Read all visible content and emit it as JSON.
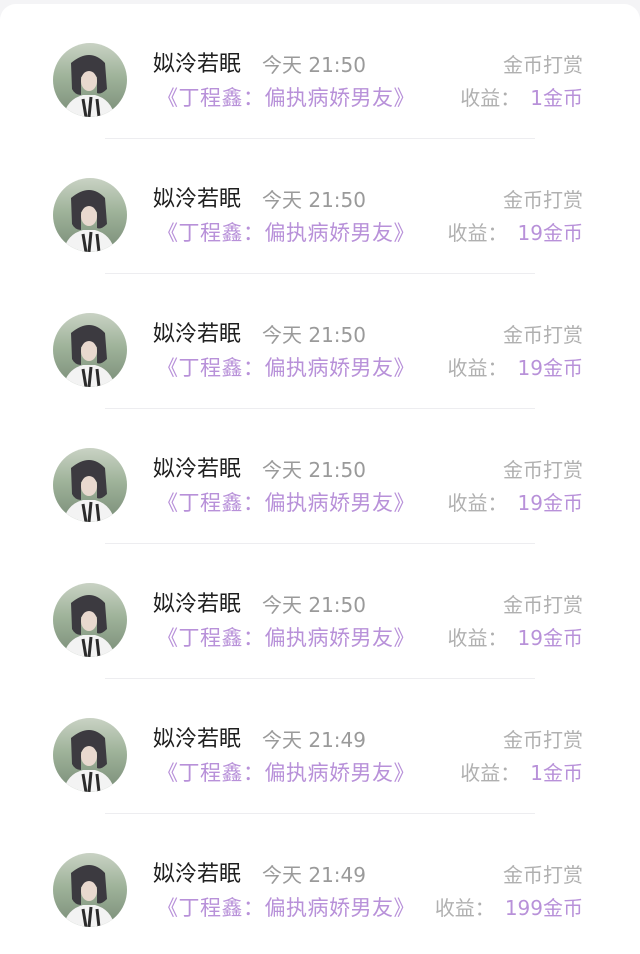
{
  "records": [
    {
      "user": "姒泠若眠",
      "time": "今天 21:50",
      "work": "《丁程鑫：偏执病娇男友》",
      "type": "金币打赏",
      "income_label": "收益：",
      "income_amount": "1金币"
    },
    {
      "user": "姒泠若眠",
      "time": "今天 21:50",
      "work": "《丁程鑫：偏执病娇男友》",
      "type": "金币打赏",
      "income_label": "收益：",
      "income_amount": "19金币"
    },
    {
      "user": "姒泠若眠",
      "time": "今天 21:50",
      "work": "《丁程鑫：偏执病娇男友》",
      "type": "金币打赏",
      "income_label": "收益：",
      "income_amount": "19金币"
    },
    {
      "user": "姒泠若眠",
      "time": "今天 21:50",
      "work": "《丁程鑫：偏执病娇男友》",
      "type": "金币打赏",
      "income_label": "收益：",
      "income_amount": "19金币"
    },
    {
      "user": "姒泠若眠",
      "time": "今天 21:50",
      "work": "《丁程鑫：偏执病娇男友》",
      "type": "金币打赏",
      "income_label": "收益：",
      "income_amount": "19金币"
    },
    {
      "user": "姒泠若眠",
      "time": "今天 21:49",
      "work": "《丁程鑫：偏执病娇男友》",
      "type": "金币打赏",
      "income_label": "收益：",
      "income_amount": "1金币"
    },
    {
      "user": "姒泠若眠",
      "time": "今天 21:49",
      "work": "《丁程鑫：偏执病娇男友》",
      "type": "金币打赏",
      "income_label": "收益：",
      "income_amount": "199金币"
    }
  ],
  "colors": {
    "accent": "#b891d9",
    "muted": "#9a9a9a",
    "name": "#1f1f1f"
  }
}
